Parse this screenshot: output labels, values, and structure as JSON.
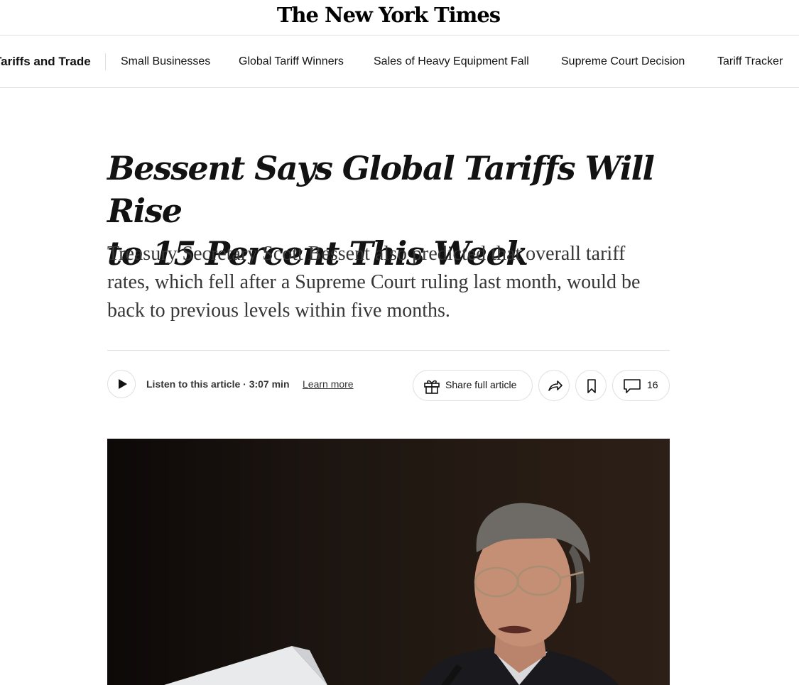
{
  "masthead": {
    "logo_text": "The New York Times"
  },
  "section_nav": {
    "title": "Tariffs and Trade",
    "items": [
      {
        "label": "Small Businesses"
      },
      {
        "label": "Global Tariff Winners"
      },
      {
        "label": "Sales of Heavy Equipment Fall"
      },
      {
        "label": "Supreme Court Decision"
      },
      {
        "label": "Tariff Tracker"
      }
    ]
  },
  "article": {
    "headline_line1": "Bessent Says Global Tariffs Will Rise",
    "headline_line2": "to 15 Percent This Week",
    "summary": "Treasury Secretary Scott Bessent also predicted that overall tariff rates, which fell after a Supreme Court ruling last month, would be back to previous levels within five months."
  },
  "listen_bar": {
    "listen_text": "Listen to this article · 3:07 min",
    "learn_more": "Learn more"
  },
  "tools": {
    "share_full_label": "Share full article",
    "comment_count": "16"
  },
  "icons": {
    "play": "play-icon",
    "gift": "gift-icon",
    "share": "share-arrow-icon",
    "save": "bookmark-icon",
    "comments": "comment-bubble-icon"
  }
}
